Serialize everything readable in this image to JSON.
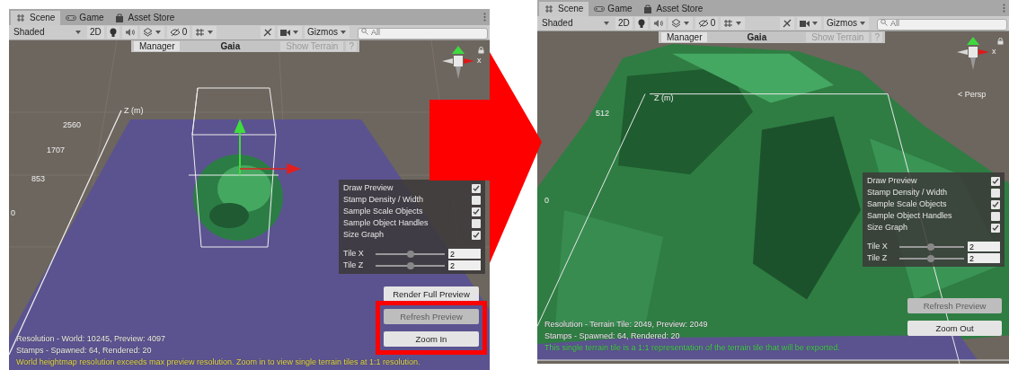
{
  "panels": [
    {
      "tabs": [
        {
          "label": "Scene",
          "selected": true
        },
        {
          "label": "Game",
          "selected": false
        },
        {
          "label": "Asset Store",
          "selected": false
        }
      ],
      "toolbar": {
        "shading": "Shaded",
        "two_d": "2D",
        "hidden_count": "0",
        "gizmos": "Gizmos",
        "search_placeholder": "All"
      },
      "gaia_bar": {
        "manager": "Manager",
        "title": "Gaia",
        "show_terrain": "Show Terrain",
        "help": "?"
      },
      "scene": {
        "kind": "overview",
        "axis_label": "Z (m)",
        "axis_ticks": [
          "2560",
          "1707",
          "853",
          "0"
        ],
        "gizmo_label": "x"
      },
      "options": [
        {
          "label": "Draw Preview",
          "checked": true
        },
        {
          "label": "Stamp Density / Width",
          "checked": false
        },
        {
          "label": "Sample Scale Objects",
          "checked": true
        },
        {
          "label": "Sample Object Handles",
          "checked": false
        },
        {
          "label": "Size Graph",
          "checked": true
        }
      ],
      "tiles": [
        {
          "label": "Tile X",
          "level": 0.5,
          "value": "2"
        },
        {
          "label": "Tile Z",
          "level": 0.5,
          "value": "2"
        }
      ],
      "buttons": [
        {
          "label": "Render Full Preview",
          "disabled": false,
          "highlighted": false
        },
        {
          "label": "Refresh Preview",
          "disabled": true,
          "highlighted": true
        },
        {
          "label": "Zoom In",
          "disabled": false,
          "highlighted": true
        }
      ],
      "status_lines": [
        "Resolution - World: 10245, Preview: 4097",
        "Stamps - Spawned: 64, Rendered: 20"
      ],
      "message": {
        "kind": "warning",
        "text": "World heightmap resolution exceeds max preview resolution. Zoom in to view single terrain tiles at 1:1 resolution."
      }
    },
    {
      "tabs": [
        {
          "label": "Scene",
          "selected": true
        },
        {
          "label": "Game",
          "selected": false
        },
        {
          "label": "Asset Store",
          "selected": false
        }
      ],
      "toolbar": {
        "shading": "Shaded",
        "two_d": "2D",
        "hidden_count": "0",
        "gizmos": "Gizmos",
        "search_placeholder": "All"
      },
      "gaia_bar": {
        "manager": "Manager",
        "title": "Gaia",
        "show_terrain": "Show Terrain",
        "help": "?"
      },
      "scene": {
        "kind": "closeup",
        "axis_label": "Z (m)",
        "axis_ticks": [
          "512",
          "0"
        ],
        "gizmo_label": "x",
        "projection_label": "< Persp"
      },
      "options": [
        {
          "label": "Draw Preview",
          "checked": true
        },
        {
          "label": "Stamp Density / Width",
          "checked": false
        },
        {
          "label": "Sample Scale Objects",
          "checked": true
        },
        {
          "label": "Sample Object Handles",
          "checked": false
        },
        {
          "label": "Size Graph",
          "checked": true
        }
      ],
      "tiles": [
        {
          "label": "Tile X",
          "level": 0.48,
          "value": "2"
        },
        {
          "label": "Tile Z",
          "level": 0.48,
          "value": "2"
        }
      ],
      "buttons": [
        {
          "label": "Refresh Preview",
          "disabled": true,
          "highlighted": false
        },
        {
          "label": "Zoom Out",
          "disabled": false,
          "highlighted": false
        }
      ],
      "status_lines": [
        "Resolution - Terrain Tile: 2049, Preview: 2049",
        "Stamps - Spawned: 64, Rendered: 20"
      ],
      "message": {
        "kind": "info",
        "text": "This single terrain tile is a 1:1 representation of the terrain tile that will be exported."
      }
    }
  ]
}
